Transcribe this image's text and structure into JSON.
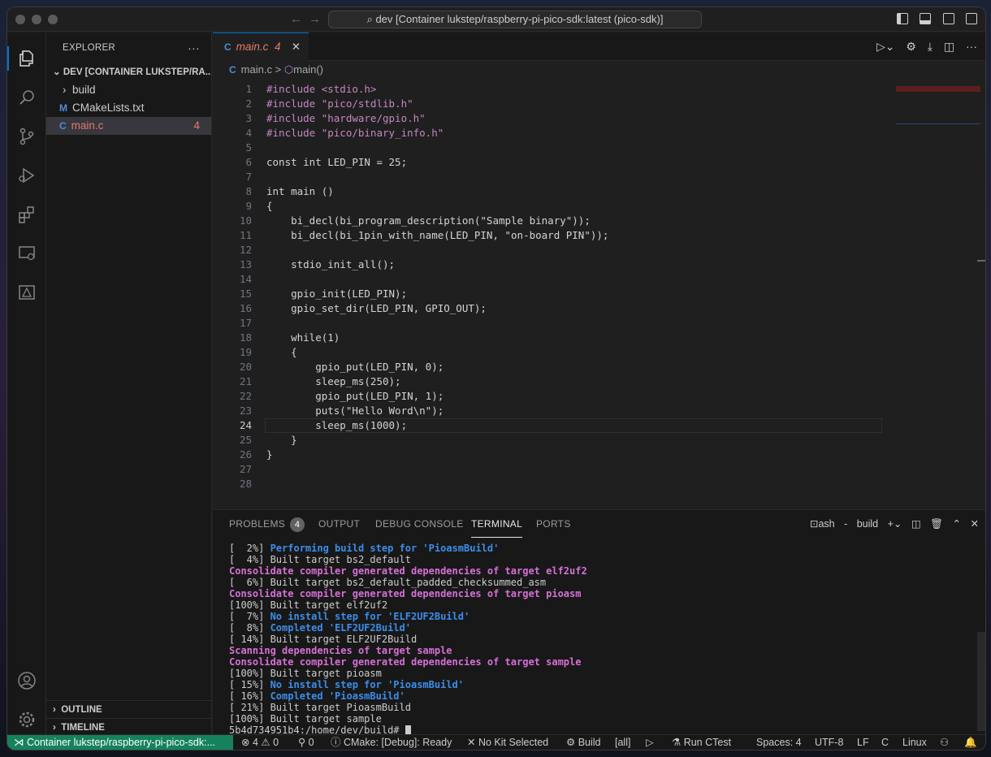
{
  "window": {
    "title": "dev [Container lukstep/raspberry-pi-pico-sdk:latest (pico-sdk)]"
  },
  "sidebar": {
    "header": "EXPLORER",
    "more": "···",
    "section_title": "DEV [CONTAINER LUKSTEP/RA...",
    "items": [
      {
        "label": "build",
        "type": "folder"
      },
      {
        "label": "CMakeLists.txt",
        "type": "cmake",
        "icon_letter": "M"
      },
      {
        "label": "main.c",
        "type": "c",
        "icon_letter": "C",
        "badge": "4"
      }
    ],
    "outline": "OUTLINE",
    "timeline": "TIMELINE"
  },
  "editor": {
    "tab": {
      "label": "main.c",
      "count": "4",
      "icon_letter": "C",
      "close": "✕"
    },
    "breadcrumb": {
      "file": "main.c",
      "separator": ">",
      "symbol": "main()"
    },
    "current_line": 24,
    "lines": [
      {
        "n": "1",
        "code": "#include <stdio.h>"
      },
      {
        "n": "2",
        "code": "#include \"pico/stdlib.h\""
      },
      {
        "n": "3",
        "code": "#include \"hardware/gpio.h\""
      },
      {
        "n": "4",
        "code": "#include \"pico/binary_info.h\""
      },
      {
        "n": "5",
        "code": ""
      },
      {
        "n": "6",
        "code": "const int LED_PIN = 25;"
      },
      {
        "n": "7",
        "code": ""
      },
      {
        "n": "8",
        "code": "int main ()"
      },
      {
        "n": "9",
        "code": "{"
      },
      {
        "n": "10",
        "code": "    bi_decl(bi_program_description(\"Sample binary\"));"
      },
      {
        "n": "11",
        "code": "    bi_decl(bi_1pin_with_name(LED_PIN, \"on-board PIN\"));"
      },
      {
        "n": "12",
        "code": ""
      },
      {
        "n": "13",
        "code": "    stdio_init_all();"
      },
      {
        "n": "14",
        "code": ""
      },
      {
        "n": "15",
        "code": "    gpio_init(LED_PIN);"
      },
      {
        "n": "16",
        "code": "    gpio_set_dir(LED_PIN, GPIO_OUT);"
      },
      {
        "n": "17",
        "code": ""
      },
      {
        "n": "18",
        "code": "    while(1)"
      },
      {
        "n": "19",
        "code": "    {"
      },
      {
        "n": "20",
        "code": "        gpio_put(LED_PIN, 0);"
      },
      {
        "n": "21",
        "code": "        sleep_ms(250);"
      },
      {
        "n": "22",
        "code": "        gpio_put(LED_PIN, 1);"
      },
      {
        "n": "23",
        "code": "        puts(\"Hello Word\\n\");"
      },
      {
        "n": "24",
        "code": "        sleep_ms(1000);"
      },
      {
        "n": "25",
        "code": "    }"
      },
      {
        "n": "26",
        "code": "}"
      },
      {
        "n": "27",
        "code": ""
      },
      {
        "n": "28",
        "code": ""
      }
    ]
  },
  "panel": {
    "tabs": {
      "problems": "PROBLEMS",
      "problems_count": "4",
      "output": "OUTPUT",
      "debug": "DEBUG CONSOLE",
      "terminal": "TERMINAL",
      "ports": "PORTS"
    },
    "terminal_name": "ash - build",
    "terminal_lines": [
      {
        "prefix": "[  2%] ",
        "text": "Performing build step for 'PioasmBuild'",
        "style": "b"
      },
      {
        "prefix": "[  4%] ",
        "text": "Built target bs2_default",
        "style": "w"
      },
      {
        "prefix": "",
        "text": "Consolidate compiler generated dependencies of target elf2uf2",
        "style": "m"
      },
      {
        "prefix": "[  6%] ",
        "text": "Built target bs2_default_padded_checksummed_asm",
        "style": "w"
      },
      {
        "prefix": "",
        "text": "Consolidate compiler generated dependencies of target pioasm",
        "style": "m"
      },
      {
        "prefix": "[100%] ",
        "text": "Built target elf2uf2",
        "style": "w"
      },
      {
        "prefix": "[  7%] ",
        "text": "No install step for 'ELF2UF2Build'",
        "style": "b"
      },
      {
        "prefix": "[  8%] ",
        "text": "Completed 'ELF2UF2Build'",
        "style": "b"
      },
      {
        "prefix": "[ 14%] ",
        "text": "Built target ELF2UF2Build",
        "style": "w"
      },
      {
        "prefix": "",
        "text": "Scanning dependencies of target sample",
        "style": "m"
      },
      {
        "prefix": "",
        "text": "Consolidate compiler generated dependencies of target sample",
        "style": "m"
      },
      {
        "prefix": "[100%] ",
        "text": "Built target pioasm",
        "style": "w"
      },
      {
        "prefix": "[ 15%] ",
        "text": "No install step for 'PioasmBuild'",
        "style": "b"
      },
      {
        "prefix": "[ 16%] ",
        "text": "Completed 'PioasmBuild'",
        "style": "b"
      },
      {
        "prefix": "[ 21%] ",
        "text": "Built target PioasmBuild",
        "style": "w"
      },
      {
        "prefix": "[100%] ",
        "text": "Built target sample",
        "style": "w"
      }
    ],
    "prompt": "5b4d734951b4:/home/dev/build# "
  },
  "statusbar": {
    "remote": "Container lukstep/raspberry-pi-pico-sdk:...",
    "errors": "4",
    "warnings": "0",
    "ports": "0",
    "cmake": "CMake: [Debug]: Ready",
    "kit": "No Kit Selected",
    "build": "Build",
    "target": "[all]",
    "ctest": "Run CTest",
    "spaces": "Spaces: 4",
    "encoding": "UTF-8",
    "eol": "LF",
    "language": "C",
    "platform": "Linux"
  }
}
